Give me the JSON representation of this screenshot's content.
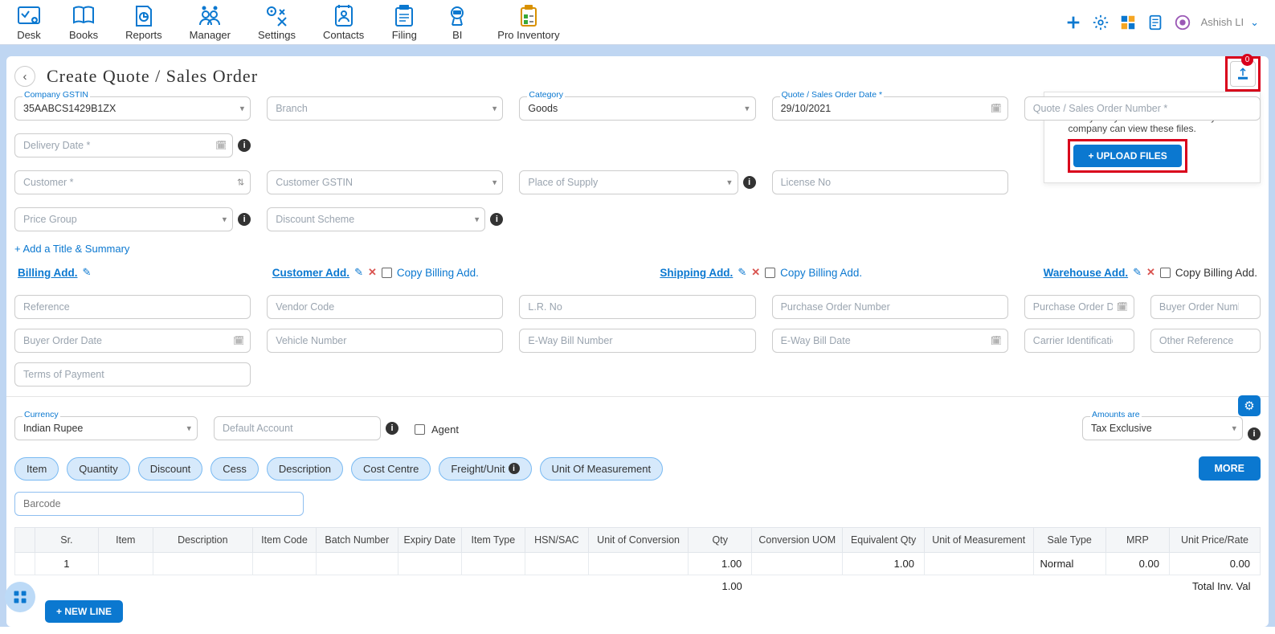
{
  "nav": [
    "Desk",
    "Books",
    "Reports",
    "Manager",
    "Settings",
    "Contacts",
    "Filing",
    "BI",
    "Pro Inventory"
  ],
  "user": "Ashish LI",
  "page_title": "Create Quote / Sales Order",
  "upload": {
    "hint": "Upload files or add files from the file library. Only users with access to your company can view these files.",
    "button": "+ UPLOAD FILES",
    "count": "0"
  },
  "form": {
    "company_gstin": {
      "label": "Company GSTIN",
      "value": "35AABCS1429B1ZX"
    },
    "branch": {
      "placeholder": "Branch"
    },
    "category": {
      "label": "Category",
      "value": "Goods"
    },
    "order_date": {
      "label": "Quote / Sales Order Date *",
      "value": "29/10/2021"
    },
    "order_number": {
      "placeholder": "Quote / Sales Order Number *"
    },
    "delivery_date": {
      "placeholder": "Delivery Date *"
    },
    "customer": {
      "placeholder": "Customer *"
    },
    "customer_gstin": {
      "placeholder": "Customer GSTIN"
    },
    "place_of_supply": {
      "placeholder": "Place of Supply"
    },
    "license": {
      "placeholder": "License No"
    },
    "price_group": {
      "placeholder": "Price Group"
    },
    "discount_scheme": {
      "placeholder": "Discount Scheme"
    }
  },
  "add_title": "+ Add a Title & Summary",
  "addr": {
    "billing": "Billing Add.",
    "customer": "Customer Add.",
    "shipping": "Shipping Add.",
    "warehouse": "Warehouse Add.",
    "copy": "Copy Billing Add."
  },
  "ref": {
    "reference": "Reference",
    "vendor_code": "Vendor Code",
    "lr_no": "L.R. No",
    "po_number": "Purchase Order Number",
    "po_date": "Purchase Order Date",
    "buyer_order_number": "Buyer Order Number",
    "buyer_order_date": "Buyer Order Date",
    "vehicle_number": "Vehicle Number",
    "eway_bill_number": "E-Way Bill Number",
    "eway_bill_date": "E-Way Bill Date",
    "carrier_id": "Carrier Identification Number",
    "other_reference": "Other Reference",
    "terms": "Terms of Payment"
  },
  "currency": {
    "label": "Currency",
    "value": "Indian Rupee"
  },
  "default_account": "Default Account",
  "agent": "Agent",
  "amounts_are": {
    "label": "Amounts are",
    "value": "Tax Exclusive"
  },
  "chips": [
    "Item",
    "Quantity",
    "Discount",
    "Cess",
    "Description",
    "Cost Centre",
    "Freight/Unit",
    "Unit Of Measurement"
  ],
  "more": "MORE",
  "barcode": "Barcode",
  "table": {
    "headers": [
      "Sr.",
      "Item",
      "Description",
      "Item Code",
      "Batch Number",
      "Expiry Date",
      "Item Type",
      "HSN/SAC",
      "Unit of Conversion",
      "Qty",
      "Conversion UOM",
      "Equivalent Qty",
      "Unit of Measurement",
      "Sale Type",
      "MRP",
      "Unit Price/Rate"
    ],
    "row": {
      "sr": "1",
      "qty": "1.00",
      "eq": "1.00",
      "sale": "Normal",
      "mrp": "0.00",
      "price": "0.00"
    },
    "total_qty": "1.00",
    "total_label": "Total Inv. Val"
  },
  "new_line": "+ NEW LINE"
}
